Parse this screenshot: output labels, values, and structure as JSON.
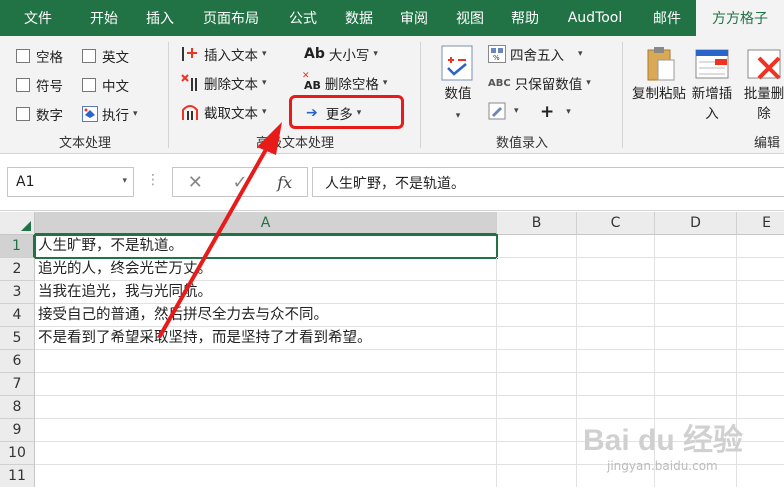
{
  "tabs": [
    "文件",
    "开始",
    "插入",
    "页面布局",
    "公式",
    "数据",
    "审阅",
    "视图",
    "帮助",
    "AudTool",
    "邮件",
    "方方格子"
  ],
  "active_tab_index": 11,
  "ribbon": {
    "text_group": {
      "label": "文本处理",
      "checks": [
        "空格",
        "英文",
        "符号",
        "中文",
        "数字"
      ],
      "execute_label": "执行"
    },
    "advanced_group": {
      "label": "高级文本处理",
      "insert_label": "插入文本",
      "delete_label": "删除文本",
      "extract_label": "截取文本",
      "case_label": "大小写",
      "case_icon_text": "Ab",
      "remove_space_label": "删除空格",
      "remove_space_icon_text": "AB",
      "more_label": "更多"
    },
    "number_group": {
      "label": "数值录入",
      "number_label": "数值",
      "round_label": "四舍五入",
      "keep_value_label": "只保留数值",
      "abc_icon_text": "ABC",
      "plus_label": "+"
    },
    "edit_group": {
      "label": "编辑",
      "copy_paste_label": "复制粘贴",
      "new_insert_label": "新增插入",
      "batch_delete_label": "批量删除"
    }
  },
  "formula_bar": {
    "name_box": "A1",
    "fx_label": "fx",
    "cancel_glyph": "✕",
    "confirm_glyph": "✓",
    "content": "人生旷野，不是轨道。"
  },
  "grid": {
    "columns": [
      "A",
      "B",
      "C",
      "D",
      "E"
    ],
    "rows": [
      "1",
      "2",
      "3",
      "4",
      "5",
      "6",
      "7",
      "8",
      "9",
      "10",
      "11"
    ],
    "cells_a": [
      "人生旷野，不是轨道。",
      "追光的人，终会光芒万丈。",
      "当我在追光，我与光同航。",
      "接受自己的普通，然后拼尽全力去与众不同。",
      "不是看到了希望采取坚持，而是坚持了才看到希望。",
      "",
      "",
      "",
      "",
      "",
      ""
    ]
  },
  "watermark": {
    "main": "Bai du 经验",
    "sub": "jingyan.baidu.com"
  },
  "colors": {
    "accent": "#217346",
    "highlight": "#e81b1b"
  }
}
